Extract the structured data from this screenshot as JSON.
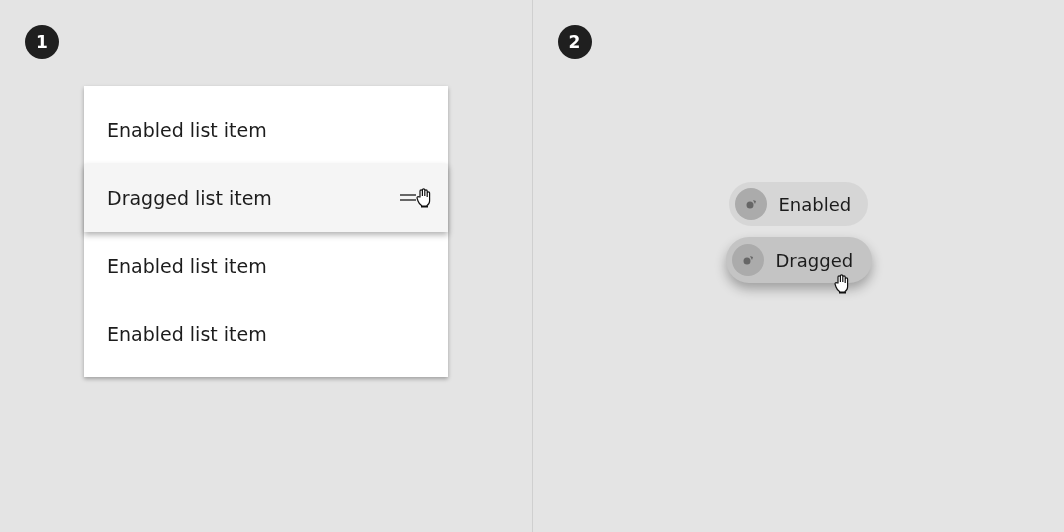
{
  "panels": [
    {
      "number": "1",
      "list": {
        "items": [
          {
            "label": "Enabled list item",
            "dragged": false
          },
          {
            "label": "Dragged list item",
            "dragged": true
          },
          {
            "label": "Enabled list item",
            "dragged": false
          },
          {
            "label": "Enabled list item",
            "dragged": false
          }
        ]
      }
    },
    {
      "number": "2",
      "chips": [
        {
          "label": "Enabled",
          "dragged": false
        },
        {
          "label": "Dragged",
          "dragged": true
        }
      ]
    }
  ]
}
